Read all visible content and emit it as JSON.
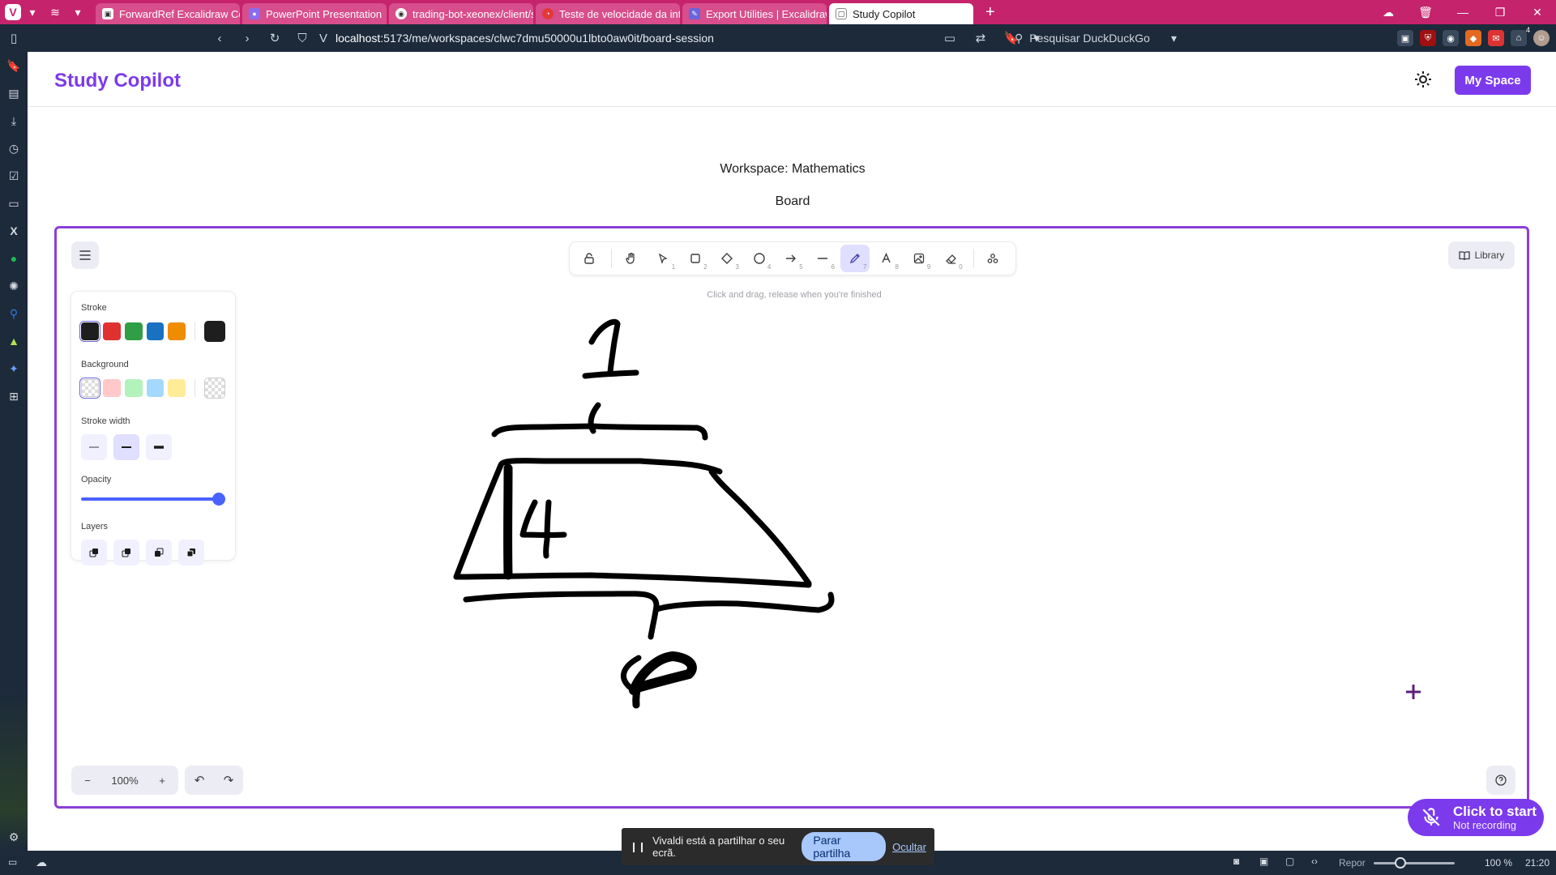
{
  "browser": {
    "tabs": [
      {
        "label": "ForwardRef Excalidraw Com",
        "favicon_color": "#ffffff"
      },
      {
        "label": "PowerPoint Presentation",
        "favicon_color": "#8a6cf0"
      },
      {
        "label": "trading-bot-xeonex/client/s",
        "favicon_color": "#ffffff"
      },
      {
        "label": "Teste de velocidade da inte",
        "favicon_color": "#e23a3a"
      },
      {
        "label": "Export Utilities | Excalidraw",
        "favicon_color": "#6965db"
      },
      {
        "label": "Study Copilot",
        "favicon_color": "#6a6a6a"
      }
    ],
    "url_host": "localhost",
    "url_path": ":5173/me/workspaces/clwc7dmu50000u1lbto0aw0it/board-session",
    "search_placeholder": "Pesquisar DuckDuckGo",
    "notification_count": "4",
    "status": {
      "repor": "Repor",
      "zoom": "100 %",
      "time": "21:20"
    }
  },
  "app": {
    "title": "Study Copilot",
    "my_space": "My Space",
    "workspace_label": "Workspace: Mathematics",
    "board_label": "Board",
    "colors": {
      "accent": "#7c3aed",
      "board_border": "#8b3fd6"
    }
  },
  "excalidraw": {
    "library_label": "Library",
    "hint": "Click and drag, release when you're finished",
    "tools": [
      {
        "name": "lock-icon",
        "key": ""
      },
      {
        "name": "hand-icon",
        "key": ""
      },
      {
        "name": "selection-icon",
        "key": "1"
      },
      {
        "name": "rectangle-icon",
        "key": "2"
      },
      {
        "name": "diamond-icon",
        "key": "3"
      },
      {
        "name": "ellipse-icon",
        "key": "4"
      },
      {
        "name": "arrow-icon",
        "key": "5"
      },
      {
        "name": "line-icon",
        "key": "6"
      },
      {
        "name": "pencil-icon",
        "key": "7"
      },
      {
        "name": "text-icon",
        "key": "8"
      },
      {
        "name": "image-icon",
        "key": "9"
      },
      {
        "name": "eraser-icon",
        "key": "0"
      },
      {
        "name": "extra-tools-icon",
        "key": ""
      }
    ],
    "props": {
      "stroke_label": "Stroke",
      "stroke_colors": [
        "#1e1e1e",
        "#e03131",
        "#2f9e44",
        "#1971c2",
        "#f08c00"
      ],
      "stroke_current": "#1e1e1e",
      "background_label": "Background",
      "background_colors": [
        "transparent",
        "#ffc9c9",
        "#b2f2bb",
        "#a5d8ff",
        "#ffec99"
      ],
      "stroke_width_label": "Stroke width",
      "opacity_label": "Opacity",
      "opacity_value": 100,
      "layers_label": "Layers"
    },
    "zoom": "100%"
  },
  "recording": {
    "title": "Click to start",
    "subtitle": "Not recording"
  },
  "share_bar": {
    "message": "Vivaldi está a partilhar o seu ecrã.",
    "stop": "Parar partilha",
    "hide": "Ocultar"
  }
}
